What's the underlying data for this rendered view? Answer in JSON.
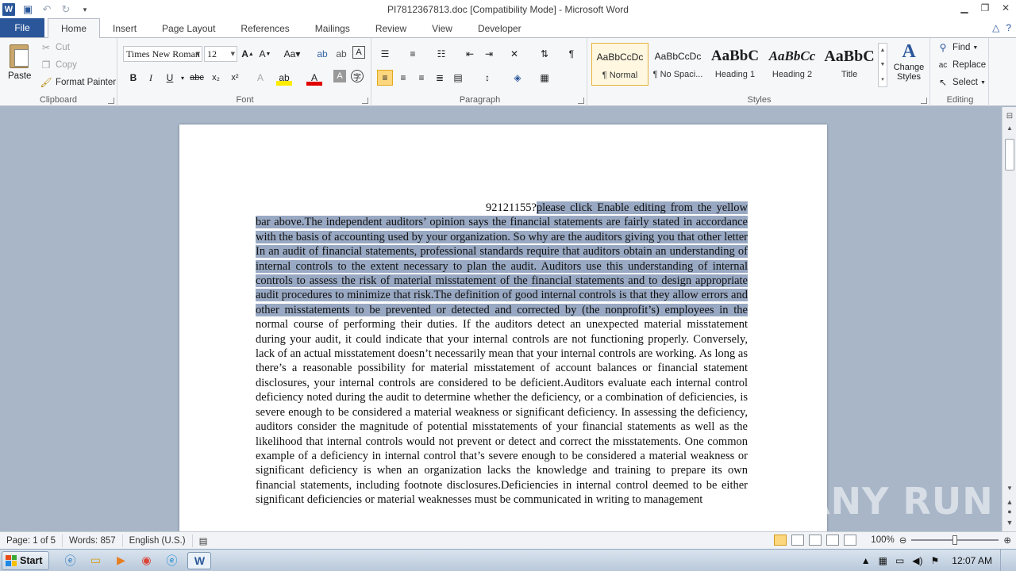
{
  "window": {
    "title": "PI7812367813.doc [Compatibility Mode]  -  Microsoft Word",
    "app_icon_letter": "W"
  },
  "ribbon_tabs": [
    "File",
    "Home",
    "Insert",
    "Page Layout",
    "References",
    "Mailings",
    "Review",
    "View",
    "Developer"
  ],
  "clipboard": {
    "paste": "Paste",
    "cut": "Cut",
    "copy": "Copy",
    "format_painter": "Format Painter",
    "label": "Clipboard"
  },
  "font": {
    "family": "Times New Roman",
    "size": "12",
    "label": "Font"
  },
  "paragraph": {
    "label": "Paragraph"
  },
  "styles": {
    "items": [
      {
        "sample": "AaBbCcDc",
        "name": "¶ Normal"
      },
      {
        "sample": "AaBbCcDc",
        "name": "¶ No Spaci..."
      },
      {
        "sample": "AaBbC",
        "name": "Heading 1"
      },
      {
        "sample": "AaBbCc",
        "name": "Heading 2"
      },
      {
        "sample": "AaBbC",
        "name": "Title"
      }
    ],
    "change_styles": "Change Styles",
    "label": "Styles"
  },
  "editing": {
    "find": "Find",
    "replace": "Replace",
    "select": "Select",
    "label": "Editing"
  },
  "document": {
    "lead": "92121155?",
    "highlighted": "please click Enable editing from the yellow bar above.The independent auditors’ opinion says the financial statements are fairly stated in accordance with the basis of accounting used by your organization. So why are the auditors giving you that other letter In an audit of financial statements, professional standards require that auditors obtain an understanding of internal controls to the extent necessary to plan the audit. Auditors use this understanding of internal controls to assess the risk of material misstatement of the financial statements and to design appropriate audit procedures to minimize that risk.The definition of good internal controls is that they allow errors and other misstatements to be prevented or detected and corrected by (the nonprofit’s) employees in the ",
    "body": "normal course of performing their duties. If the auditors detect an unexpected material misstatement during your audit, it could indicate that your internal controls are not functioning properly. Conversely, lack of an actual misstatement doesn’t necessarily mean that your internal controls are working. As long as there’s a reasonable possibility for material misstatement of account balances or financial statement disclosures, your internal controls are considered to be deficient.Auditors evaluate each internal control deficiency noted during the audit to determine whether the deficiency, or a combination of deficiencies, is severe enough to be considered a material weakness or significant deficiency. In assessing the deficiency, auditors consider the magnitude of potential misstatements of your financial statements as well as the likelihood that internal controls would not prevent or detect and correct the misstatements. One common example of a deficiency in internal control that’s severe enough to be considered a material weakness or significant deficiency is when an organization lacks the knowledge and training to prepare its own financial statements, including footnote disclosures.Deficiencies in internal control deemed to be either significant deficiencies or material weaknesses must be communicated in writing to management"
  },
  "statusbar": {
    "page": "Page: 1 of 5",
    "words": "Words: 857",
    "language": "English (U.S.)",
    "zoom": "100%",
    "zoom_fraction": 0.5
  },
  "watermark": "ANY RUN",
  "taskbar": {
    "start": "Start",
    "clock": "12:07 AM"
  }
}
